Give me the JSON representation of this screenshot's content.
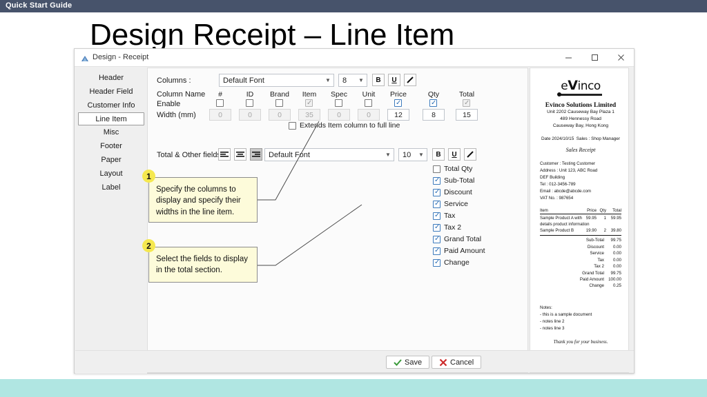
{
  "slide": {
    "header_label": "Quick Start Guide",
    "title": "Design Receipt – Line Item",
    "footer_color": "#b0e6e2",
    "header_color": "#47536b"
  },
  "window": {
    "title": "Design - Receipt",
    "icon": "app-icon",
    "controls": {
      "minimize": "–",
      "maximize": "□",
      "close": "✕"
    }
  },
  "sidebar": {
    "items": [
      {
        "label": "Header",
        "selected": false
      },
      {
        "label": "Header Field",
        "selected": false
      },
      {
        "label": "Customer Info",
        "selected": false
      },
      {
        "label": "Line Item",
        "selected": true
      },
      {
        "label": "Misc",
        "selected": false
      },
      {
        "label": "Footer",
        "selected": false
      },
      {
        "label": "Paper",
        "selected": false
      },
      {
        "label": "Layout",
        "selected": false
      },
      {
        "label": "Label",
        "selected": false
      }
    ]
  },
  "columns_section": {
    "label": "Columns :",
    "font_value": "Default Font",
    "font_size_value": "8",
    "bold_label": "B",
    "underline_label": "U",
    "color_label": "pen",
    "row_labels": {
      "column_name": "Column Name",
      "enable": "Enable",
      "width": "Width (mm)"
    },
    "columns": [
      {
        "name": "#",
        "enabled": false,
        "enabled_disabled": false,
        "width": "0",
        "width_disabled": true
      },
      {
        "name": "ID",
        "enabled": false,
        "enabled_disabled": false,
        "width": "0",
        "width_disabled": true
      },
      {
        "name": "Brand",
        "enabled": false,
        "enabled_disabled": false,
        "width": "0",
        "width_disabled": true
      },
      {
        "name": "Item",
        "enabled": true,
        "enabled_disabled": true,
        "width": "35",
        "width_disabled": true
      },
      {
        "name": "Spec",
        "enabled": false,
        "enabled_disabled": false,
        "width": "0",
        "width_disabled": true
      },
      {
        "name": "Unit",
        "enabled": false,
        "enabled_disabled": false,
        "width": "0",
        "width_disabled": true
      },
      {
        "name": "Price",
        "enabled": true,
        "enabled_disabled": false,
        "width": "12",
        "width_disabled": false
      },
      {
        "name": "Qty",
        "enabled": true,
        "enabled_disabled": false,
        "width": "8",
        "width_disabled": false
      },
      {
        "name": "Total",
        "enabled": true,
        "enabled_disabled": true,
        "width": "15",
        "width_disabled": false
      }
    ],
    "extends_label": "Extends Item column to full line",
    "extends_checked": false
  },
  "totals_section": {
    "label": "Total & Other fields :",
    "align_buttons": [
      {
        "name": "align-left",
        "pressed": false
      },
      {
        "name": "align-center",
        "pressed": false
      },
      {
        "name": "align-right",
        "pressed": true
      }
    ],
    "font_value": "Default Font",
    "font_size_value": "10",
    "bold_label": "B",
    "underline_label": "U",
    "fields": [
      {
        "label": "Total Qty",
        "checked": false
      },
      {
        "label": "Sub-Total",
        "checked": true
      },
      {
        "label": "Discount",
        "checked": true
      },
      {
        "label": "Service",
        "checked": true
      },
      {
        "label": "Tax",
        "checked": true
      },
      {
        "label": "Tax 2",
        "checked": true
      },
      {
        "label": "Grand Total",
        "checked": true
      },
      {
        "label": "Paid Amount",
        "checked": true
      },
      {
        "label": "Change",
        "checked": true
      }
    ]
  },
  "callouts": [
    {
      "number": "1",
      "text": "Specify the columns to display and specify their widths in the line item."
    },
    {
      "number": "2",
      "text": "Select the fields to display in the total section."
    }
  ],
  "footer_buttons": {
    "save_label": "Save",
    "cancel_label": "Cancel"
  },
  "receipt": {
    "logo_e": "e",
    "logo_v": "V",
    "logo_rest": "inco",
    "company": "Evinco Solutions Limited",
    "address_lines": [
      "Unit 2202 Causeway Bay Plaza 1",
      "489 Hennessy Road",
      "Causeway Bay, Hong Kong"
    ],
    "date_label": "Date 2024/10/15",
    "sales_label": "Sales : Shop Manager",
    "doc_type": "Sales Receipt",
    "customer_lines": [
      "Customer : Testing Customer",
      "Address : Unit 123, ABC Road",
      "DEF Building",
      "Tel : 012-3456-789",
      "Email : abcde@abcde.com",
      "VAT No. : 987654"
    ],
    "item_headers": {
      "item": "Item",
      "price": "Price",
      "qty": "Qty",
      "total": "Total"
    },
    "items": [
      {
        "name": "Sample Product A with",
        "name2": "details product information",
        "price": "59.95",
        "qty": "1",
        "total": "59.95"
      },
      {
        "name": "Sample Product B",
        "name2": "",
        "price": "19.90",
        "qty": "2",
        "total": "39.80"
      }
    ],
    "totals": [
      {
        "label": "Sub-Total",
        "value": "99.75"
      },
      {
        "label": "Discount",
        "value": "0.00"
      },
      {
        "label": "Service",
        "value": "0.00"
      },
      {
        "label": "Tax",
        "value": "0.00"
      },
      {
        "label": "Tax 2",
        "value": "0.00"
      },
      {
        "label": "Grand Total",
        "value": "99.75"
      },
      {
        "label": "Paid Amount",
        "value": "100.00"
      },
      {
        "label": "Change",
        "value": "0.25"
      }
    ],
    "notes_title": "Notes:",
    "notes_lines": [
      "- this is a sample document",
      "- notes line 2",
      "- notes line 3"
    ],
    "thanks": "Thank you for your business."
  }
}
